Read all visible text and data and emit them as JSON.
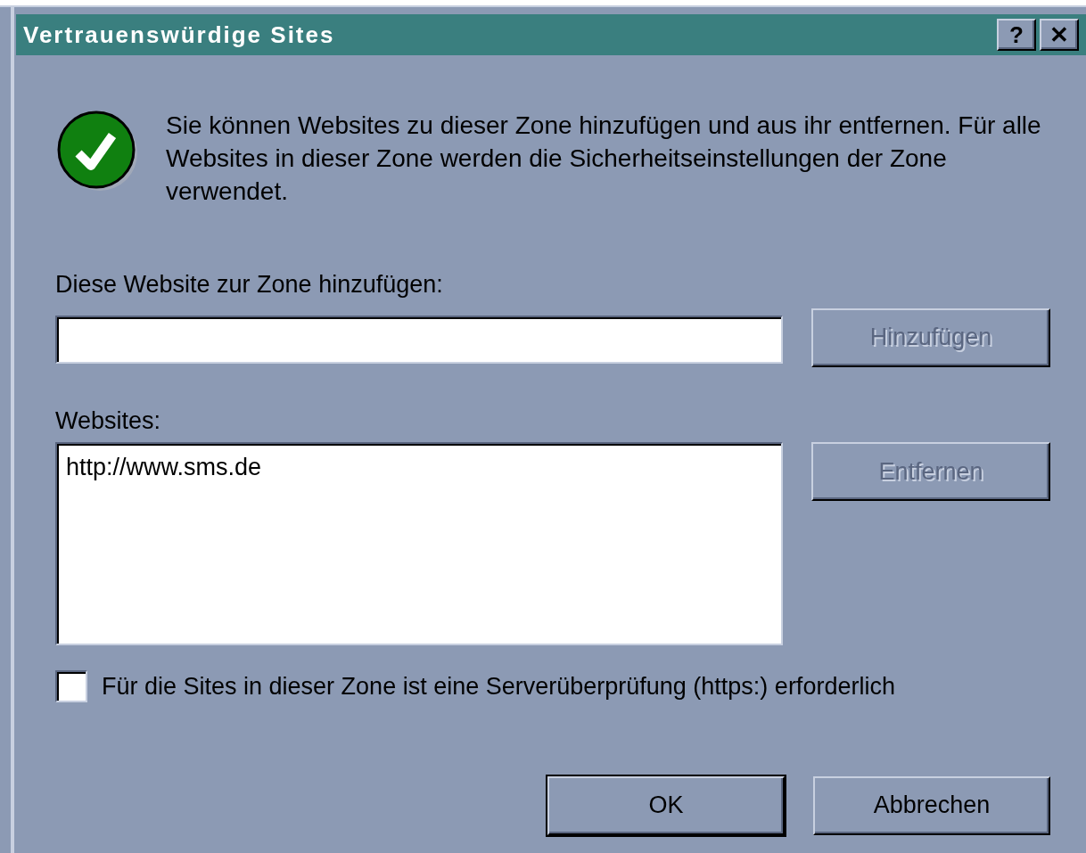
{
  "window": {
    "title": "Vertrauenswürdige Sites",
    "title_buttons": [
      "?",
      "✕"
    ]
  },
  "intro": {
    "text": "Sie können Websites zu dieser Zone hinzufügen und aus ihr entfernen. Für alle Websites in dieser Zone werden die Sicherheitseinstellungen der Zone verwendet."
  },
  "add_site": {
    "label": "Diese Website zur Zone hinzufügen:",
    "button": {
      "label": "Hinzufügen",
      "disabled": true
    }
  },
  "websites": {
    "label": "Websites:",
    "items": [
      {
        "text": "http://www.sms.de",
        "selected": false
      }
    ],
    "button": {
      "label": "Entfernen",
      "disabled": true
    }
  },
  "require_https": {
    "label": "Für die Sites in dieser Zone ist eine Serverüberprüfung (https:) erforderlich",
    "checked": false
  },
  "buttons": [
    {
      "label": "OK",
      "default": true
    },
    {
      "label": "Abbrechen",
      "default": false
    }
  ]
}
